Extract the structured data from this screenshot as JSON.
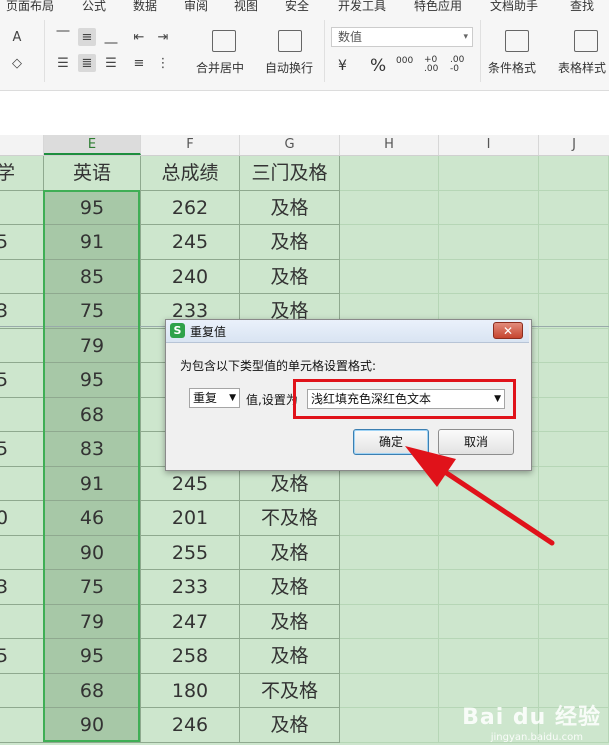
{
  "menu": {
    "items": [
      "页面布局",
      "公式",
      "数据",
      "审阅",
      "视图",
      "安全",
      "开发工具",
      "特色应用",
      "文档助手",
      "查找"
    ]
  },
  "ribbon": {
    "merge_label": "合并居中",
    "wrap_label": "自动换行",
    "number_format_value": "数值",
    "cond_format_label": "条件格式",
    "table_style_label": "表格样式",
    "currency_symbol": "¥",
    "percent_symbol": "%",
    "thousands_symbol": "000",
    "inc_decimal_label": "+0 .00",
    "dec_decimal_label": ".00 -0"
  },
  "columns": {
    "headers": [
      "E",
      "F",
      "G",
      "H",
      "I",
      "J"
    ],
    "active": "E"
  },
  "table": {
    "header_row": {
      "d": "学",
      "e": "英语",
      "f": "总成绩",
      "g": "三门及格"
    },
    "rows": [
      {
        "d": "",
        "e": "95",
        "f": "262",
        "g": "及格"
      },
      {
        "d": "5",
        "e": "91",
        "f": "245",
        "g": "及格"
      },
      {
        "d": "",
        "e": "85",
        "f": "240",
        "g": "及格"
      },
      {
        "d": "3",
        "e": "75",
        "f": "233",
        "g": "及格"
      },
      {
        "d": "",
        "e": "79",
        "f": "",
        "g": ""
      },
      {
        "d": "5",
        "e": "95",
        "f": "",
        "g": ""
      },
      {
        "d": "",
        "e": "68",
        "f": "",
        "g": ""
      },
      {
        "d": "5",
        "e": "83",
        "f": "",
        "g": ""
      },
      {
        "d": "",
        "e": "91",
        "f": "245",
        "g": "及格"
      },
      {
        "d": "0",
        "e": "46",
        "f": "201",
        "g": "不及格"
      },
      {
        "d": "",
        "e": "90",
        "f": "255",
        "g": "及格"
      },
      {
        "d": "3",
        "e": "75",
        "f": "233",
        "g": "及格"
      },
      {
        "d": "",
        "e": "79",
        "f": "247",
        "g": "及格"
      },
      {
        "d": "5",
        "e": "95",
        "f": "258",
        "g": "及格"
      },
      {
        "d": "",
        "e": "68",
        "f": "180",
        "g": "不及格"
      },
      {
        "d": "",
        "e": "90",
        "f": "246",
        "g": "及格"
      }
    ]
  },
  "dialog": {
    "logo_letter": "S",
    "title": "重复值",
    "close_symbol": "✕",
    "description": "为包含以下类型值的单元格设置格式:",
    "type_value": "重复",
    "middle_label": "值,设置为",
    "format_value": "浅红填充色深红色文本",
    "ok_label": "确定",
    "cancel_label": "取消"
  },
  "watermark": {
    "text": "Bai du 经验",
    "sub": "jingyan.baidu.com"
  },
  "colors": {
    "grid_bg": "#cde6cd",
    "selected_col_bg": "#a7c8a7",
    "selection_border": "#3fae55",
    "highlight_frame": "#e0121a",
    "arrow": "#e0121a"
  }
}
